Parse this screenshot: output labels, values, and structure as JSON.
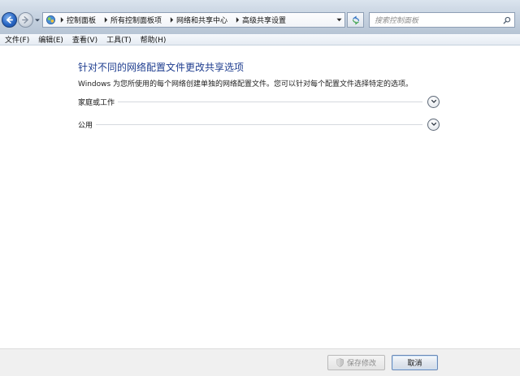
{
  "addressbar": {
    "breadcrumbs": [
      "控制面板",
      "所有控制面板项",
      "网络和共享中心",
      "高级共享设置"
    ],
    "search_placeholder": "搜索控制面板"
  },
  "menubar": {
    "items": [
      "文件(F)",
      "编辑(E)",
      "查看(V)",
      "工具(T)",
      "帮助(H)"
    ]
  },
  "main": {
    "title": "针对不同的网络配置文件更改共享选项",
    "description": "Windows 为您所使用的每个网络创建单独的网络配置文件。您可以针对每个配置文件选择特定的选项。",
    "profiles": [
      {
        "label": "家庭或工作",
        "expanded": false
      },
      {
        "label": "公用",
        "expanded": false
      }
    ]
  },
  "footer": {
    "save_label": "保存修改",
    "save_enabled": false,
    "cancel_label": "取消"
  },
  "icons": {
    "back": "arrow-left-icon",
    "forward": "arrow-right-icon",
    "recent": "chevron-down-icon",
    "control_panel": "control-panel-icon",
    "breadcrumb_separator": "chevron-right-icon",
    "refresh": "refresh-icon",
    "search": "search-icon",
    "expand": "chevron-down-icon",
    "uac": "uac-shield-icon"
  },
  "colors": {
    "title": "#1e3d8f",
    "addressbar_top": "#dbe4ee",
    "addressbar_bottom": "#b6c4d4",
    "back_button": "#2a67c4",
    "footer_bg": "#f0f0f0"
  }
}
